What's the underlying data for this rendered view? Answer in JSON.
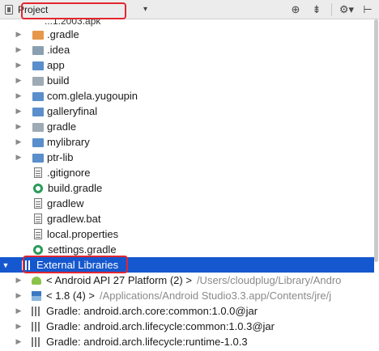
{
  "toolbar": {
    "view_label": "Project",
    "dropdown_icon": "chevron-down-icon",
    "actions": [
      "locate-icon",
      "collapse-icon",
      "gear-icon",
      "hide-icon"
    ]
  },
  "tree": {
    "partial_top_label": "...1.2003.apk",
    "items": [
      {
        "label": ".gradle",
        "icon": "folder-orange-icon"
      },
      {
        "label": ".idea",
        "icon": "folder-idea-icon"
      },
      {
        "label": "app",
        "icon": "module-folder-icon"
      },
      {
        "label": "build",
        "icon": "folder-icon"
      },
      {
        "label": "com.glela.yugoupin",
        "icon": "module-folder-icon"
      },
      {
        "label": "galleryfinal",
        "icon": "module-folder-icon"
      },
      {
        "label": "gradle",
        "icon": "folder-icon"
      },
      {
        "label": "mylibrary",
        "icon": "module-folder-icon"
      },
      {
        "label": "ptr-lib",
        "icon": "module-folder-icon"
      },
      {
        "label": ".gitignore",
        "icon": "file-icon"
      },
      {
        "label": "build.gradle",
        "icon": "gradle-icon"
      },
      {
        "label": "gradlew",
        "icon": "file-icon"
      },
      {
        "label": "gradlew.bat",
        "icon": "file-icon"
      },
      {
        "label": "local.properties",
        "icon": "file-icon"
      },
      {
        "label": "settings.gradle",
        "icon": "gradle-icon"
      }
    ],
    "external_libraries_label": "External Libraries",
    "libraries": [
      {
        "label": "< Android API 27 Platform (2) >",
        "path": "/Users/cloudplug/Library/Andro"
      },
      {
        "label": "< 1.8 (4) >",
        "path": "/Applications/Android Studio3.3.app/Contents/jre/j"
      },
      {
        "label": "Gradle: android.arch.core:common:1.0.0@jar",
        "path": ""
      },
      {
        "label": "Gradle: android.arch.lifecycle:common:1.0.3@jar",
        "path": ""
      },
      {
        "label": "Gradle: android.arch.lifecycle:runtime-1.0.3",
        "path": ""
      }
    ]
  },
  "colors": {
    "selection": "#1557ce",
    "highlight_box": "#e2262f",
    "gradle_green": "#2a9b5a"
  }
}
